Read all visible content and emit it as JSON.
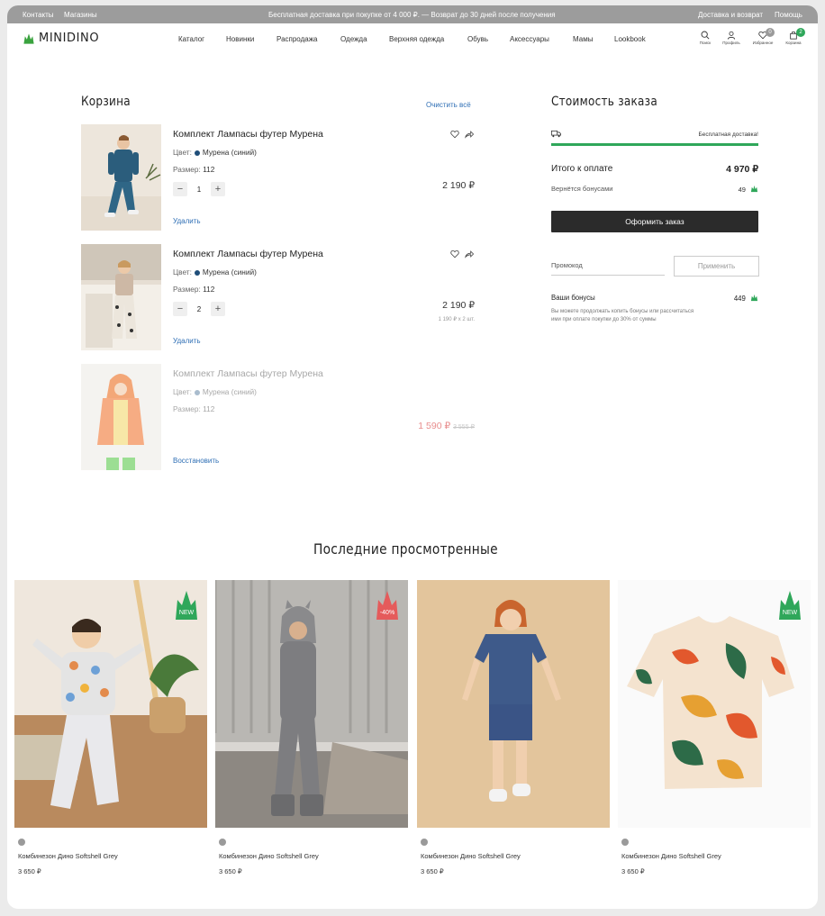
{
  "topbar": {
    "left": [
      "Контакты",
      "Магазины"
    ],
    "promo": "Бесплатная доставка при покупке от 4 000 ₽. — Возврат до 30 дней после получения",
    "right": [
      "Доставка и возврат",
      "Помощь"
    ]
  },
  "header": {
    "logo": "MINIDINO",
    "nav": [
      "Каталог",
      "Новинки",
      "Распродажа",
      "Одежда",
      "Верхняя одежда",
      "Обувь",
      "Аксессуары",
      "Мамы",
      "Lookbook"
    ],
    "icons": [
      {
        "icon": "search-icon",
        "label": "Поиск"
      },
      {
        "icon": "user-icon",
        "label": "Профиль"
      },
      {
        "icon": "heart-icon",
        "label": "Избранное",
        "badge": "0"
      },
      {
        "icon": "bag-icon",
        "label": "Корзина",
        "badge": "2"
      }
    ],
    "badge_colors": {
      "favorites": "#9a9a9a",
      "cart": "#2fa75a"
    }
  },
  "cart": {
    "title": "Корзина",
    "clear_all": "Очистить всё",
    "items": [
      {
        "name": "Комплект Лампасы футер Мурена",
        "color_label": "Цвет:",
        "color": "Мурена (синий)",
        "color_hex": "#1f4e79",
        "size_label": "Размер:",
        "size": "112",
        "qty": "1",
        "price": "2 190 ₽",
        "action": "Удалить"
      },
      {
        "name": "Комплект Лампасы футер Мурена",
        "color_label": "Цвет:",
        "color": "Мурена (синий)",
        "color_hex": "#1f4e79",
        "size_label": "Размер:",
        "size": "112",
        "qty": "2",
        "price": "2 190 ₽",
        "sub": "1 190 ₽ x 2 шт.",
        "action": "Удалить"
      },
      {
        "name": "Комплект Лампасы футер Мурена",
        "color_label": "Цвет:",
        "color": "Мурена (синий)",
        "color_hex": "#a9bccd",
        "size_label": "Размер:",
        "size": "112",
        "price": "1 590 ₽",
        "old_price": "3 555 ₽",
        "action": "Восстановить"
      }
    ]
  },
  "summary": {
    "title": "Стоимость заказа",
    "free_delivery": "Бесплатная доставка!",
    "total_label": "Итого к оплате",
    "total": "4 970 ₽",
    "bonus_back_label": "Вернётся бонусами",
    "bonus_back": "49",
    "order_button": "Оформить заказ",
    "promo_placeholder": "Промокод",
    "apply_button": "Применить",
    "your_bonus_label": "Ваши бонусы",
    "your_bonus": "449",
    "bonus_note_1": "Вы можете продолжать копить бонусы или рассчитаться",
    "bonus_note_2": "ими при оплате покупки до 30% от суммы",
    "progress": 1.0,
    "accent": "#2fa75a"
  },
  "recent": {
    "title": "Последние просмотренные",
    "products": [
      {
        "name": "Комбинезон Дино Softshell Grey",
        "price": "3 650 ₽",
        "badge": "NEW",
        "badge_color": "#2fa75a"
      },
      {
        "name": "Комбинезон Дино Softshell Grey",
        "price": "3 650 ₽",
        "badge": "-40%",
        "badge_color": "#e55b5b"
      },
      {
        "name": "Комбинезон Дино Softshell Grey",
        "price": "3 650 ₽"
      },
      {
        "name": "Комбинезон Дино Softshell Grey",
        "price": "3 650 ₽",
        "badge": "NEW",
        "badge_color": "#2fa75a"
      }
    ]
  }
}
